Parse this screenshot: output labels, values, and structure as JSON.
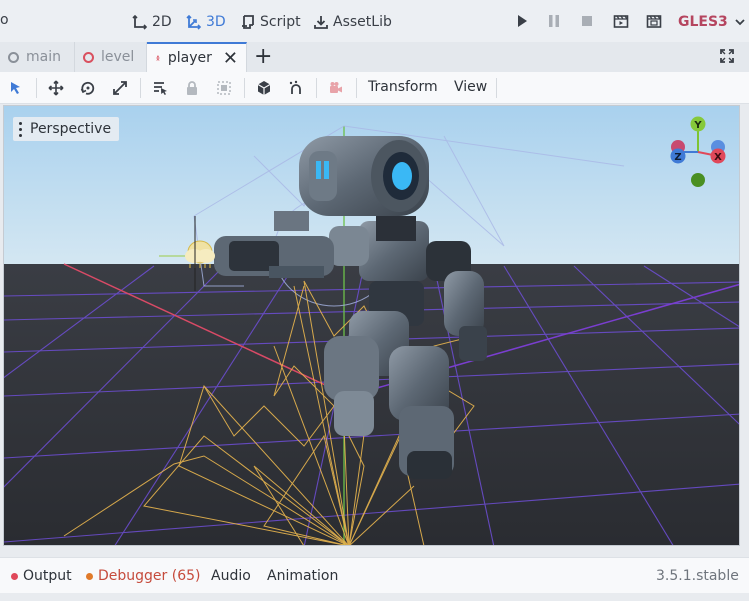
{
  "top": {
    "left_fragment": "o",
    "modes": [
      {
        "label": "2D",
        "icon": "2d-icon"
      },
      {
        "label": "3D",
        "icon": "3d-icon",
        "active": true
      },
      {
        "label": "Script",
        "icon": "script-icon"
      },
      {
        "label": "AssetLib",
        "icon": "assetlib-icon"
      }
    ],
    "renderer": "GLES3",
    "accent": "#3f7ad6",
    "renderer_color": "#b5455f"
  },
  "tabs": [
    {
      "label": "main",
      "active": false
    },
    {
      "label": "level",
      "active": false
    },
    {
      "label": "player",
      "active": true
    }
  ],
  "toolbar": {
    "menus": [
      "Transform",
      "View"
    ]
  },
  "viewport": {
    "mode_label": "Perspective",
    "gizmo": {
      "y": "Y",
      "z": "Z",
      "x": "X"
    }
  },
  "bottom": {
    "output": "Output",
    "debugger": "Debugger (65)",
    "audio": "Audio",
    "animation": "Animation",
    "version": "3.5.1.stable",
    "output_dot": "#e0485a",
    "debugger_dot": "#e07a2a",
    "debugger_color": "#c64b3c"
  }
}
